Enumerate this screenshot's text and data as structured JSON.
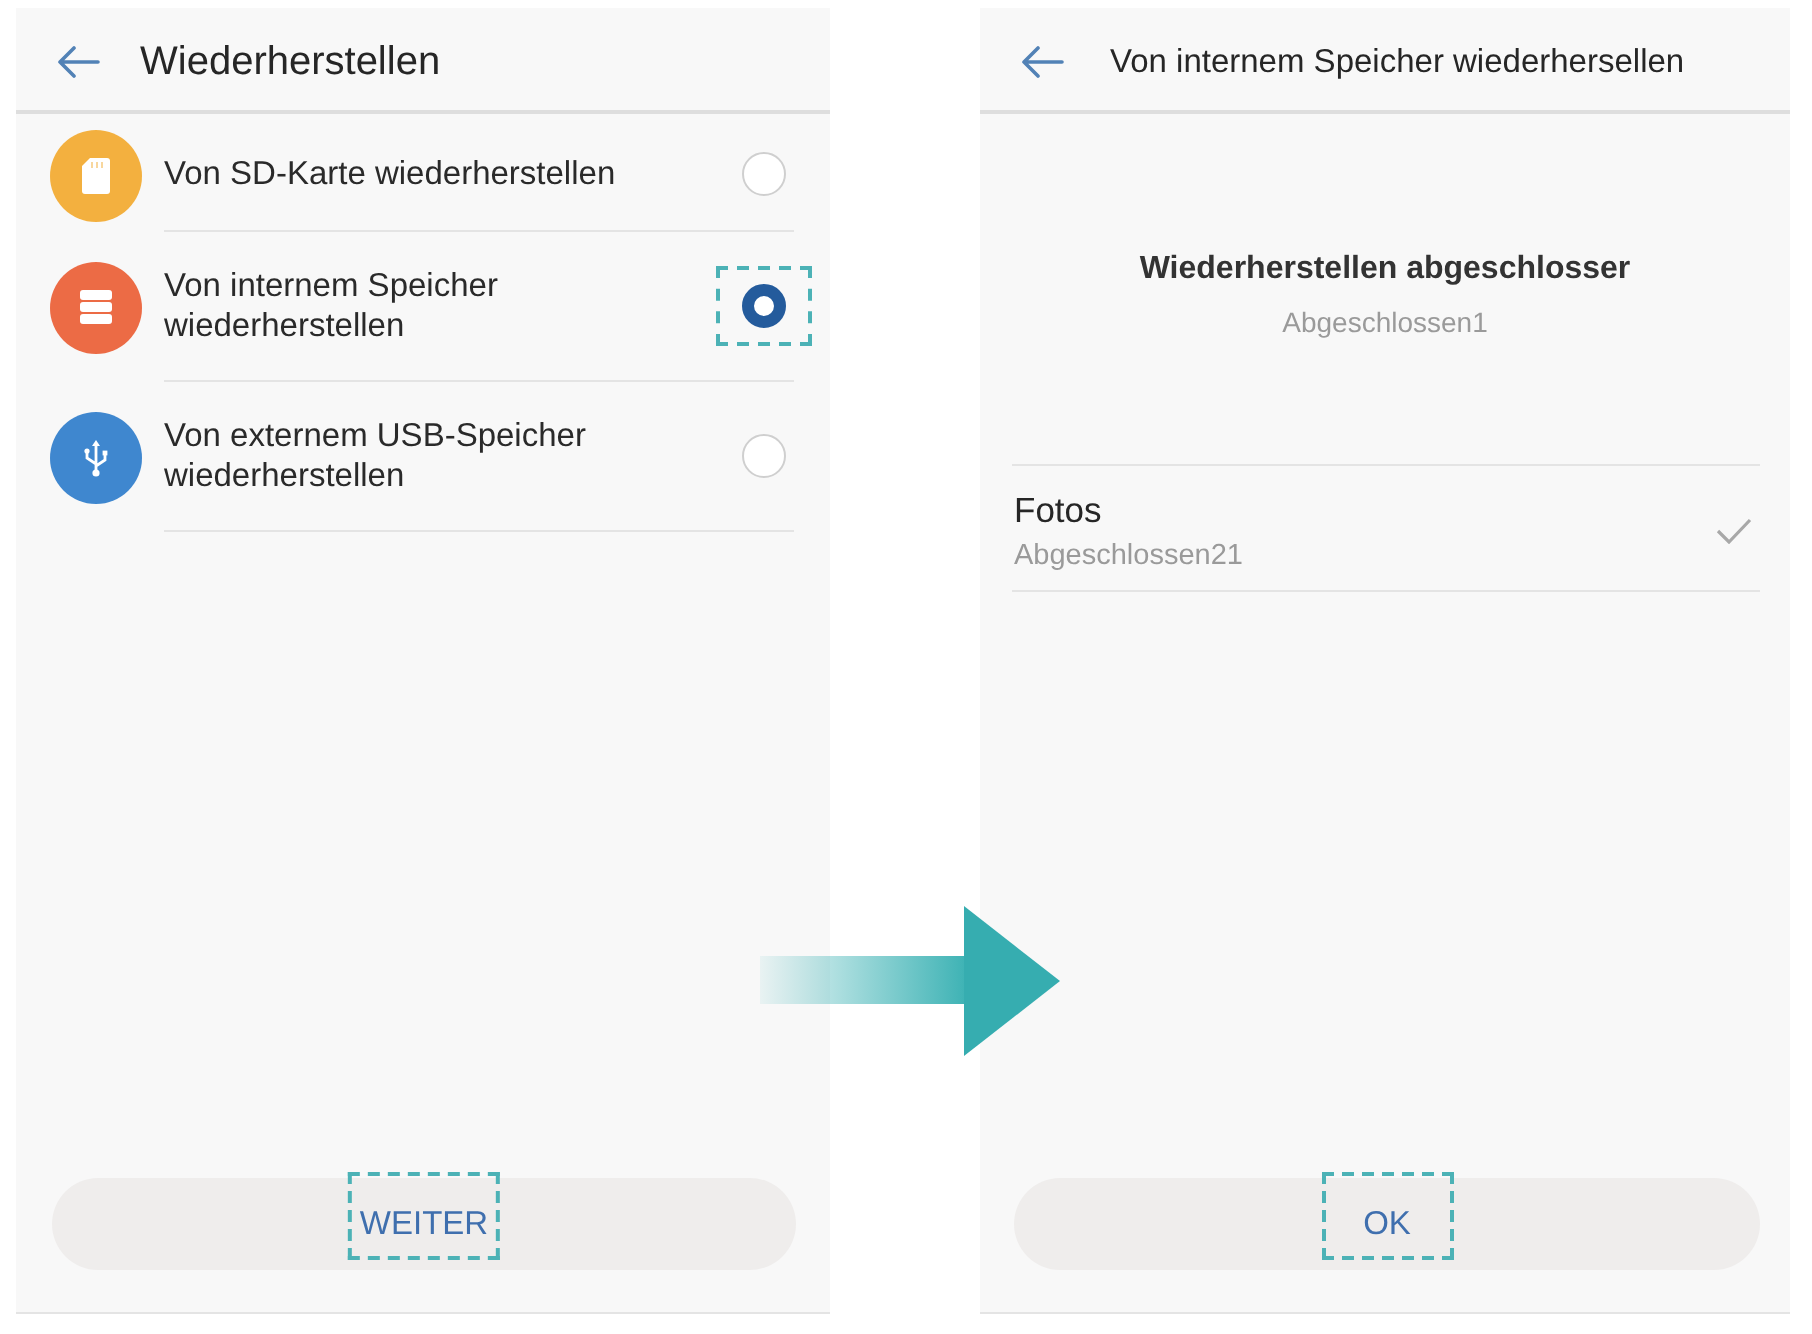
{
  "left_screen": {
    "header": {
      "title": "Wiederherstellen"
    },
    "options": [
      {
        "label": "Von SD-Karte wiederherstellen",
        "kind": "sdcard",
        "color": "#f3b03f",
        "selected": false,
        "highlighted": false
      },
      {
        "label": "Von internem Speicher wiederherstellen",
        "kind": "storage",
        "color": "#ec6b45",
        "selected": true,
        "highlighted": true
      },
      {
        "label": "Von externem USB-Speicher wiederherstellen",
        "kind": "usb",
        "color": "#3f87cf",
        "selected": false,
        "highlighted": false
      }
    ],
    "button": {
      "label": "WEITER",
      "highlighted": true
    }
  },
  "right_screen": {
    "header": {
      "title": "Von internem Speicher wiederhersellen"
    },
    "result": {
      "title": "Wiederherstellen abgeschlosser",
      "subtitle": "Abgeschlossen1"
    },
    "items": [
      {
        "title": "Fotos",
        "status": "Abgeschlossen21",
        "checked": true
      }
    ],
    "button": {
      "label": "OK",
      "highlighted": true
    }
  }
}
